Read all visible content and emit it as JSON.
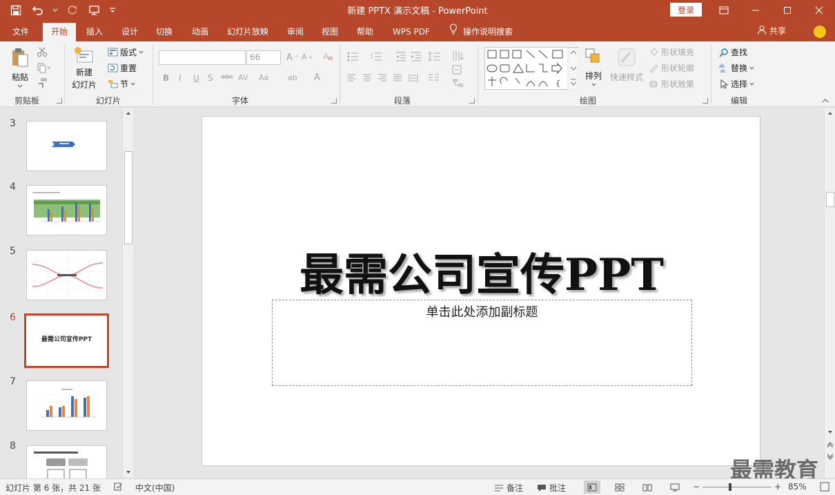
{
  "window": {
    "title": "新建 PPTX 演示文稿  -  PowerPoint",
    "login_label": "登录"
  },
  "tabs": [
    "文件",
    "开始",
    "插入",
    "设计",
    "切换",
    "动画",
    "幻灯片放映",
    "审阅",
    "视图",
    "帮助",
    "WPS PDF"
  ],
  "active_tab": "开始",
  "tell_me": "操作说明搜索",
  "share_label": "共享",
  "ribbon": {
    "clipboard": {
      "label": "剪贴板",
      "paste": "粘贴"
    },
    "slides": {
      "label": "幻灯片",
      "new_slide_1": "新建",
      "new_slide_2": "幻灯片",
      "layout": "版式",
      "reset": "重置",
      "section": "节"
    },
    "font": {
      "label": "字体",
      "font_name": "",
      "font_size": "66"
    },
    "paragraph": {
      "label": "段落"
    },
    "drawing": {
      "label": "绘图",
      "arrange": "排列",
      "quick_styles": "快速样式",
      "shape_fill": "形状填充",
      "shape_outline": "形状轮廓",
      "shape_effects": "形状效果"
    },
    "editing": {
      "label": "编辑",
      "find": "查找",
      "replace": "替换",
      "select": "选择"
    }
  },
  "slides_pane": {
    "items": [
      {
        "num": "3"
      },
      {
        "num": "4"
      },
      {
        "num": "5"
      },
      {
        "num": "6",
        "thumb_text": "最需公司宣传PPT"
      },
      {
        "num": "7"
      },
      {
        "num": "8"
      }
    ],
    "selected": "6"
  },
  "slide": {
    "title": "最需公司宣传PPT",
    "subtitle_placeholder": "单击此处添加副标题"
  },
  "watermark": "最需教育",
  "status": {
    "slide_info": "幻灯片 第 6 张，共 21 张",
    "language": "中文(中国)",
    "notes": "备注",
    "comments": "批注",
    "zoom": "85%"
  },
  "colors": {
    "brand": "#b7472a",
    "selected_border": "#c0462b"
  }
}
